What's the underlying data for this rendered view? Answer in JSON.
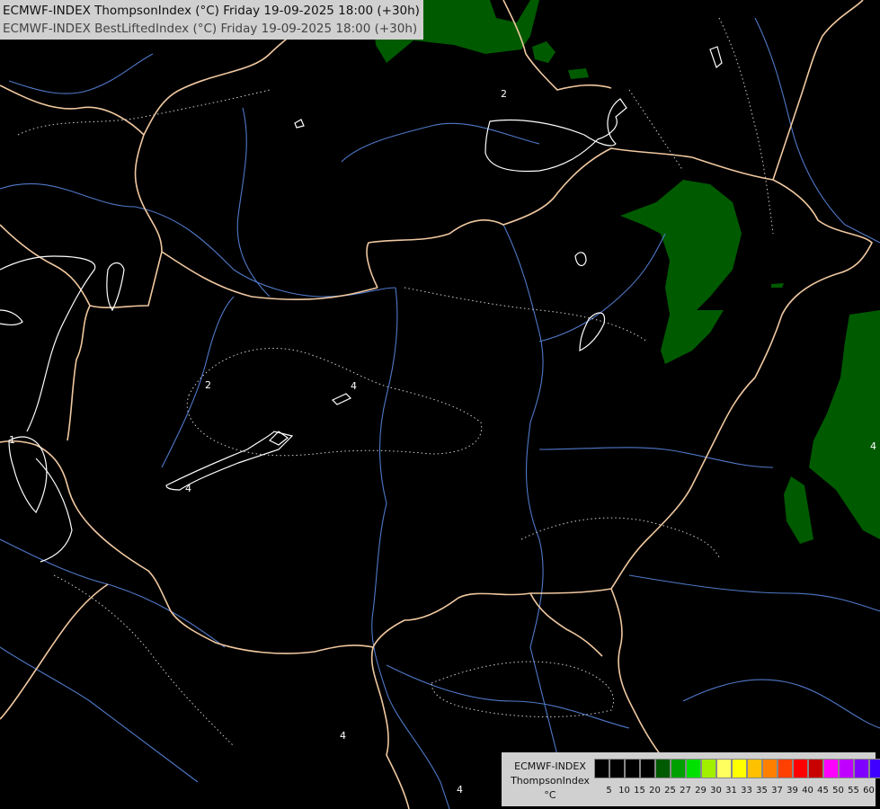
{
  "titles": {
    "line1": "ECMWF-INDEX ThompsonIndex (°C) Friday 19-09-2025 18:00 (+30h)",
    "line2": "ECMWF-INDEX BestLiftedIndex (°C) Friday 19-09-2025 18:00 (+30h)"
  },
  "legend": {
    "model": "ECMWF-INDEX",
    "parameter": "ThompsonIndex",
    "unit": "°C",
    "ticks": [
      "5",
      "10",
      "15",
      "20",
      "25",
      "27",
      "29",
      "30",
      "31",
      "33",
      "35",
      "37",
      "39",
      "40",
      "45",
      "50",
      "55",
      "60"
    ],
    "colors": [
      "#000000",
      "#000000",
      "#000000",
      "#000000",
      "#005a00",
      "#00a000",
      "#00e000",
      "#a0f000",
      "#ffff60",
      "#ffff00",
      "#ffc000",
      "#ff8000",
      "#ff4000",
      "#ff0000",
      "#c80000",
      "#ff00ff",
      "#c000ff",
      "#8000ff",
      "#4000ff",
      "#0000ff"
    ]
  },
  "contour_labels": [
    "2",
    "2",
    "4",
    "4",
    "4",
    "1",
    "4",
    "4"
  ],
  "colors": {
    "background": "#000000",
    "thompson_fill": "#005a00",
    "border": "#f0c8a0",
    "river": "#5078c8",
    "contour": "#ffffff"
  }
}
